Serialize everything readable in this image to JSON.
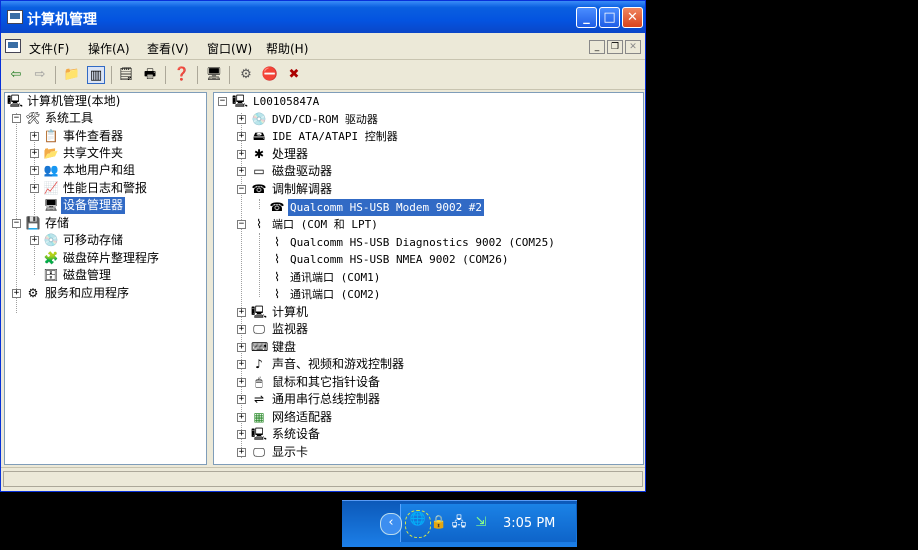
{
  "window": {
    "title": "计算机管理",
    "buttons": {
      "minimize": "_",
      "maximize": "□",
      "close": "✕"
    }
  },
  "menu": [
    {
      "label": "文件(F)"
    },
    {
      "label": "操作(A)"
    },
    {
      "label": "查看(V)"
    },
    {
      "label": "窗口(W)"
    },
    {
      "label": "帮助(H)"
    }
  ],
  "icons": {
    "back": "back-arrow-icon",
    "forward": "forward-arrow-icon",
    "up": "up-folder-icon",
    "tree": "show-tree-icon",
    "properties": "properties-icon",
    "print": "print-icon",
    "help": "help-icon",
    "scan": "scan-hardware-icon",
    "update": "update-driver-icon",
    "disable": "disable-device-icon",
    "uninstall": "uninstall-device-icon"
  },
  "left_tree": [
    {
      "label": "计算机管理(本地)"
    },
    {
      "label": "系统工具"
    },
    {
      "label": "事件查看器"
    },
    {
      "label": "共享文件夹"
    },
    {
      "label": "本地用户和组"
    },
    {
      "label": "性能日志和警报"
    },
    {
      "label": "设备管理器"
    },
    {
      "label": "存储"
    },
    {
      "label": "可移动存储"
    },
    {
      "label": "磁盘碎片整理程序"
    },
    {
      "label": "磁盘管理"
    },
    {
      "label": "服务和应用程序"
    }
  ],
  "device_tree": [
    {
      "label": "L00105847A"
    },
    {
      "label": "DVD/CD-ROM 驱动器"
    },
    {
      "label": "IDE ATA/ATAPI 控制器"
    },
    {
      "label": "处理器"
    },
    {
      "label": "磁盘驱动器"
    },
    {
      "label": "调制解调器"
    },
    {
      "label": "Qualcomm HS-USB Modem 9002 #2"
    },
    {
      "label": "端口 (COM 和 LPT)"
    },
    {
      "label": "Qualcomm HS-USB Diagnostics 9002 (COM25)"
    },
    {
      "label": "Qualcomm HS-USB NMEA 9002 (COM26)"
    },
    {
      "label": "通讯端口 (COM1)"
    },
    {
      "label": "通讯端口 (COM2)"
    },
    {
      "label": "计算机"
    },
    {
      "label": "监视器"
    },
    {
      "label": "键盘"
    },
    {
      "label": "声音、视频和游戏控制器"
    },
    {
      "label": "鼠标和其它指针设备"
    },
    {
      "label": "通用串行总线控制器"
    },
    {
      "label": "网络适配器"
    },
    {
      "label": "系统设备"
    },
    {
      "label": "显示卡"
    }
  ],
  "taskbar": {
    "clock": "3:05 PM"
  }
}
